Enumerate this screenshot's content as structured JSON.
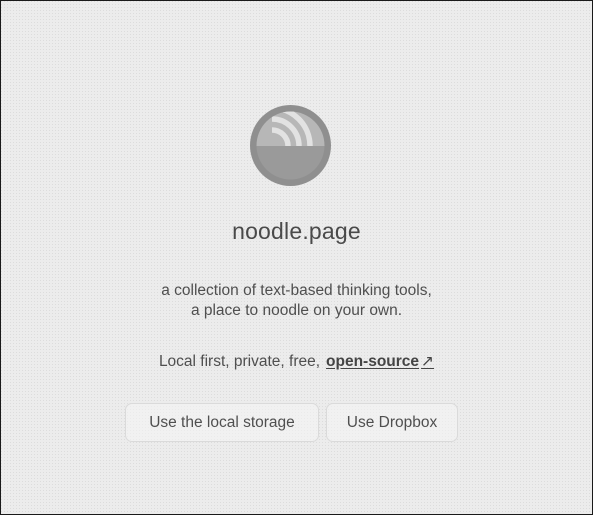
{
  "app": {
    "title": "noodle.page",
    "logo_icon": "signal-waves-circle-icon",
    "colors": {
      "logo_outer": "#8f8f8f",
      "logo_top": "#b7b7b7",
      "logo_bottom": "#9a9a9a",
      "text": "#4f4f4f"
    }
  },
  "tagline": {
    "line1": "a collection of text-based thinking tools,",
    "line2": "a place to noodle on your own."
  },
  "features": {
    "text": "Local first, private, free,",
    "link_label": "open-source",
    "link_icon": "↗"
  },
  "actions": {
    "local_storage_label": "Use the local storage",
    "dropbox_label": "Use Dropbox"
  }
}
